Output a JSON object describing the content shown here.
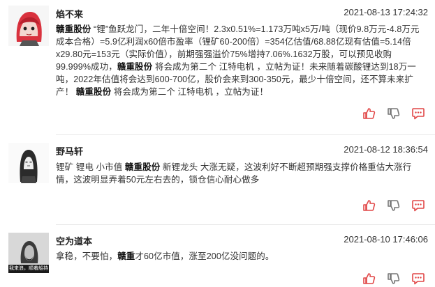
{
  "colors": {
    "accent": "#e14747",
    "divider": "#e8e8e8"
  },
  "posts": [
    {
      "author": "焰不来",
      "time": "2021-08-13 17:24:32",
      "avatar_icon": "red-haired-girl-avatar",
      "segments": [
        {
          "t": "赣重股份",
          "b": true
        },
        {
          "t": " “锂”鱼跃龙门，二年十倍空间！2.3x0.51%=1.173万吨x5万/吨（现价9.8万元-4.8万元成本合格）=5.9亿利润x60倍市盈率（锂矿60-200倍）=354亿估值/68.88亿现有估值=5.14倍x29.80元=153元（实际价值），前期强强溢价75%增持7.06%.1632万股，可以预见收购99.999%成功，",
          "b": false
        },
        {
          "t": "赣重股份",
          "b": true
        },
        {
          "t": " 将会成为第二个 江特电机 ，立帖为证！未来随着碳酸锂达到18万一吨，2022年估值将会达到600-700亿，股价会来到300-350元，最少十倍空间，还不算未来扩产！ ",
          "b": false
        },
        {
          "t": "赣重股份",
          "b": true
        },
        {
          "t": " 将会成为第二个 江特电机 ，立帖为证！",
          "b": false
        }
      ]
    },
    {
      "author": "野马轩",
      "time": "2021-08-12 18:36:54",
      "avatar_icon": "sketch-person-avatar",
      "segments": [
        {
          "t": "锂矿 锂电 小市值 ",
          "b": false
        },
        {
          "t": "赣重股份",
          "b": true
        },
        {
          "t": " 新锂龙头 大涨无疑，这波利好不断超预期强支撑价格重估大涨行情，这波明显弄着50元左右去的，锁仓信心耐心做多",
          "b": false
        }
      ]
    },
    {
      "author": "空为道本",
      "time": "2021-08-10 17:46:06",
      "avatar_icon": "meme-photo-avatar",
      "avatar_caption": "我来浪，顺着船持",
      "segments": [
        {
          "t": "拿稳，不要怕，",
          "b": false
        },
        {
          "t": "赣重",
          "b": true
        },
        {
          "t": "才60亿市值，涨至200亿没问题的。",
          "b": false
        }
      ]
    }
  ]
}
